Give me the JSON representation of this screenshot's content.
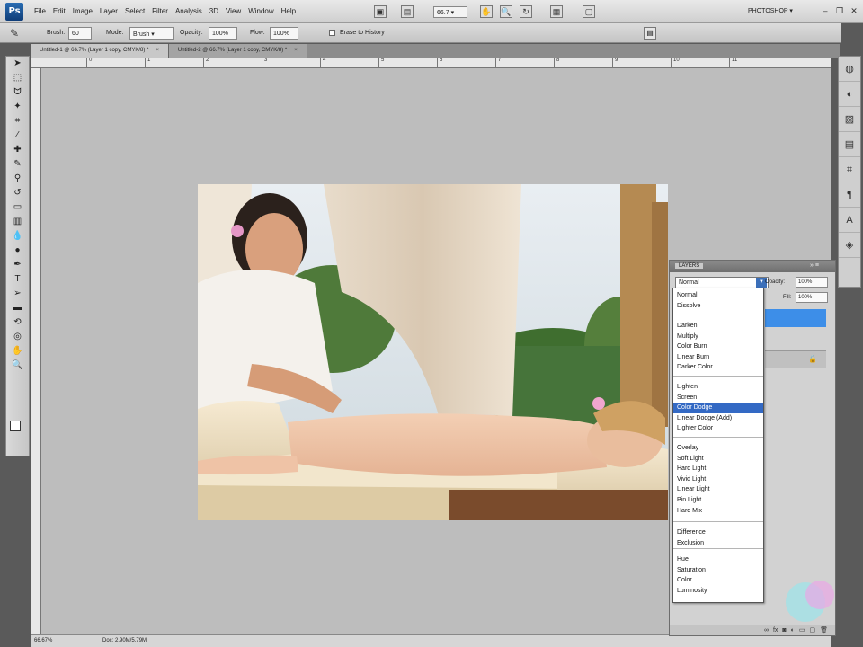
{
  "app": {
    "logo": "Ps",
    "menu": [
      "File",
      "Edit",
      "Image",
      "Layer",
      "Select",
      "Filter",
      "Analysis",
      "3D",
      "View",
      "Window",
      "Help"
    ],
    "zoom": "66.7",
    "workspace": "PHOTOSHOP ▾"
  },
  "options": {
    "brush_label": "Brush:",
    "brush_size": "60",
    "mode_label": "Mode:",
    "mode_value": "Brush",
    "opacity_label": "Opacity:",
    "opacity_value": "100%",
    "flow_label": "Flow:",
    "flow_value": "100%",
    "erase_label": "Erase to History"
  },
  "tabs": [
    {
      "label": "Untitled-1 @ 66.7% (Layer 1 copy, CMYK/8) *"
    },
    {
      "label": "Untitled-2 @ 66.7% (Layer 1 copy, CMYK/8) *"
    }
  ],
  "ruler_ticks": [
    "0",
    "1",
    "2",
    "3",
    "4",
    "5",
    "6",
    "7",
    "8",
    "9",
    "10",
    "11"
  ],
  "status": {
    "zoom": "66.67%",
    "doc": "Doc: 2.90M/5.79M"
  },
  "layers_panel": {
    "title": "LAYERS",
    "blend_current": "Normal",
    "opacity_label": "Opacity:",
    "opacity_value": "100%",
    "fill_label": "Fill:",
    "fill_value": "100%"
  },
  "blend_modes": [
    [
      "Normal",
      "Dissolve"
    ],
    [
      "Darken",
      "Multiply",
      "Color Burn",
      "Linear Burn",
      "Darker Color"
    ],
    [
      "Lighten",
      "Screen",
      "Color Dodge",
      "Linear Dodge (Add)",
      "Lighter Color"
    ],
    [
      "Overlay",
      "Soft Light",
      "Hard Light",
      "Vivid Light",
      "Linear Light",
      "Pin Light",
      "Hard Mix"
    ],
    [
      "Difference",
      "Exclusion"
    ],
    [
      "Hue",
      "Saturation",
      "Color",
      "Luminosity"
    ]
  ],
  "highlighted_mode": "Color Dodge",
  "colors": {
    "accent": "#3369c4",
    "canvas": "#bdbdbd",
    "selected_layer": "#3d8ee8"
  }
}
